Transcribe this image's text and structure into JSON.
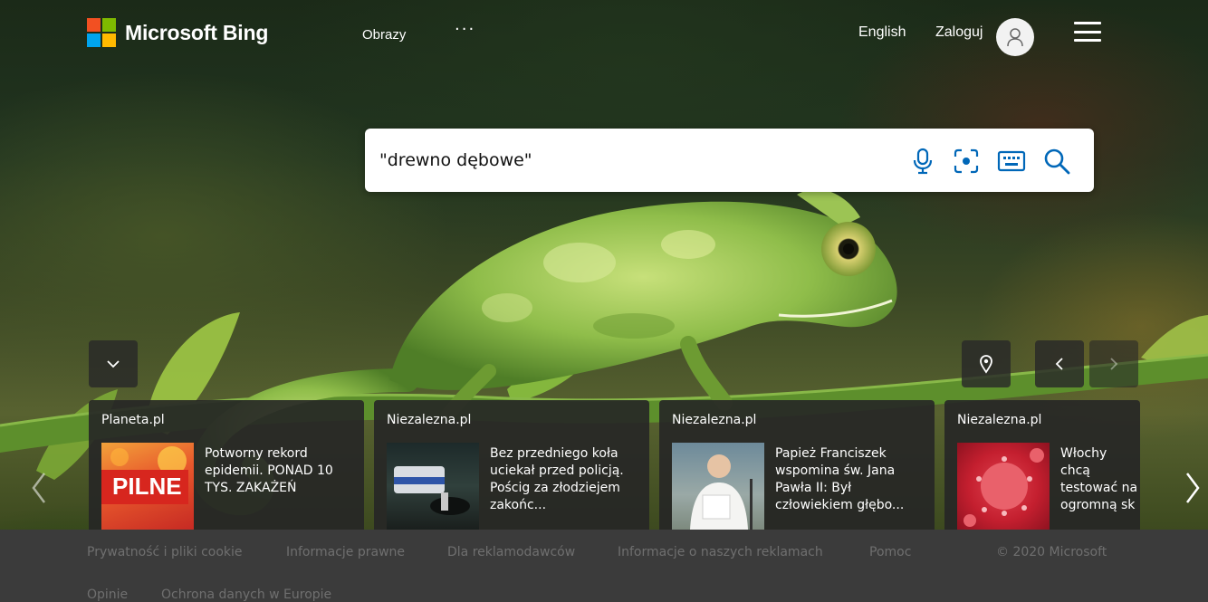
{
  "header": {
    "brand": "Microsoft Bing",
    "nav_images": "Obrazy",
    "nav_more": "···",
    "language": "English",
    "sign_in": "Zaloguj"
  },
  "search": {
    "value": "\"drewno dębowe\"",
    "placeholder": ""
  },
  "news": [
    {
      "source": "Planeta.pl",
      "title": "Potworny rekord epidemii. PONAD 10 TYS. ZAKAŻEŃ",
      "thumb_text": "PILNE"
    },
    {
      "source": "Niezalezna.pl",
      "title": "Bez przedniego koła uciekał przed policją. Pościg za złodziejem zakońc..."
    },
    {
      "source": "Niezalezna.pl",
      "title": "Papież Franciszek wspomina św. Jana Pawła II: Był człowiekiem głębo..."
    },
    {
      "source": "Niezalezna.pl",
      "title": "Włochy chcą testować na ogromną sk"
    }
  ],
  "footer": {
    "links": [
      "Prywatność i pliki cookie",
      "Informacje prawne",
      "Dla reklamodawców",
      "Informacje o naszych reklamach",
      "Pomoc",
      "Opinie",
      "Ochrona danych w Europie"
    ],
    "copyright": "© 2020 Microsoft"
  },
  "icons": {
    "mic": "microphone-icon",
    "visual": "visual-search-icon",
    "keyboard": "keyboard-icon",
    "search": "search-icon",
    "location": "location-pin-icon"
  },
  "colors": {
    "logo_red": "#f25022",
    "logo_green": "#7fba00",
    "logo_blue": "#00a4ef",
    "logo_yellow": "#ffb900",
    "accent": "#0067b8",
    "footer_bg": "#3b3b3b"
  }
}
